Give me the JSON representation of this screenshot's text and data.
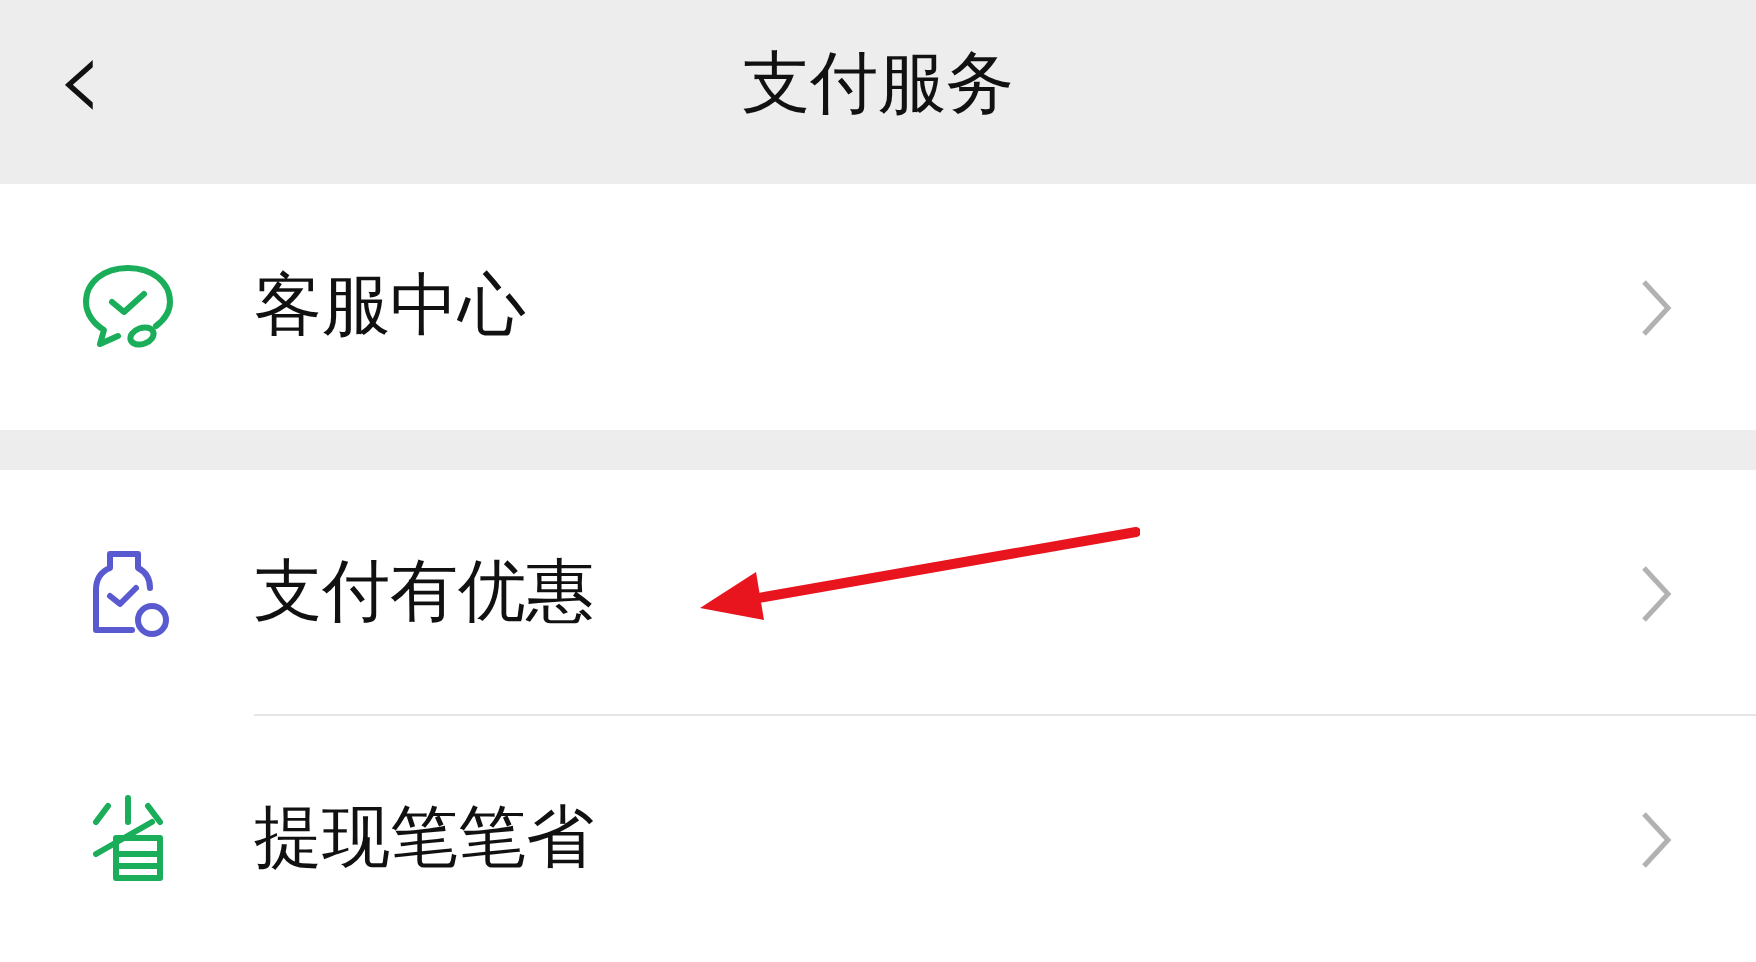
{
  "header": {
    "back": "‹",
    "title": "支付服务"
  },
  "sections": [
    {
      "items": [
        {
          "label": "客服中心"
        }
      ]
    },
    {
      "items": [
        {
          "label": "支付有优惠"
        },
        {
          "label": "提现笔笔省"
        }
      ]
    }
  ]
}
